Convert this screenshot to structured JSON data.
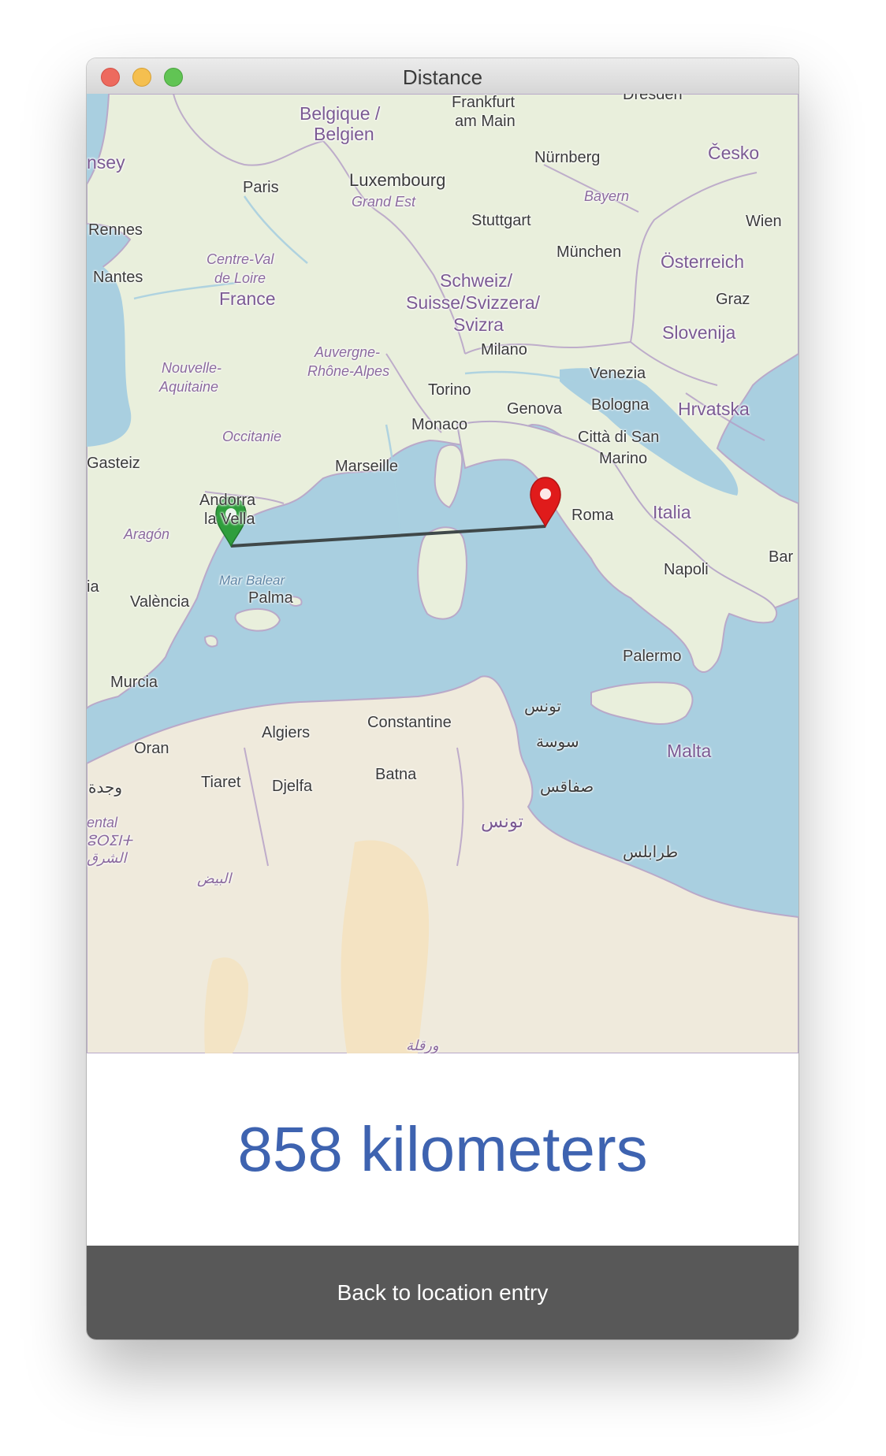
{
  "window": {
    "title": "Distance",
    "traffic_lights": [
      "close-button",
      "minimize-button",
      "zoom-button"
    ]
  },
  "map": {
    "labels": {
      "belgique": "Belgique /",
      "belgien": "Belgien",
      "frankfurt": "Frankfurt",
      "am_main": "am Main",
      "dresden": "Dresden",
      "cesko": "Česko",
      "nurnberg": "Nürnberg",
      "bayern": "Bayern",
      "jersey": "nsey",
      "paris": "Paris",
      "luxembourg": "Luxembourg",
      "grand_est": "Grand Est",
      "stuttgart": "Stuttgart",
      "wien": "Wien",
      "rennes": "Rennes",
      "centre_val": "Centre-Val",
      "de_loire": "de Loire",
      "munchen": "München",
      "osterreich": "Österreich",
      "nantes": "Nantes",
      "france": "France",
      "schweiz": "Schweiz/",
      "suisse": "Suisse/Svizzera/",
      "svizra": "Svizra",
      "graz": "Graz",
      "slovenija": "Slovenija",
      "auvergne": "Auvergne-",
      "rhone": "Rhône-Alpes",
      "milano": "Milano",
      "nouvelle": "Nouvelle-",
      "aquitaine": "Aquitaine",
      "torino": "Torino",
      "venezia": "Venezia",
      "genova": "Genova",
      "bologna": "Bologna",
      "hrvatska": "Hrvatska",
      "monaco": "Monaco",
      "occitanie": "Occitanie",
      "citta": "Città di San",
      "marino": "Marino",
      "gasteiz": "Gasteiz",
      "marseille": "Marseille",
      "andorra": "Andorra",
      "la_vella": "la Vella",
      "roma": "Roma",
      "italia": "Italia",
      "aragon": "Aragón",
      "bari": "Bar",
      "napoli": "Napoli",
      "mar_balear": "Mar Balear",
      "ia": "ia",
      "valencia": "València",
      "palma": "Palma",
      "palermo": "Palermo",
      "murcia": "Murcia",
      "tunis_city": "تونس",
      "constantine": "Constantine",
      "algiers": "Algiers",
      "sousse": "سوسة",
      "oran": "Oran",
      "malta": "Malta",
      "tiaret": "Tiaret",
      "djelfa": "Djelfa",
      "batna": "Batna",
      "oujda": "وجدة",
      "sfax": "صفاقس",
      "tunisia": "تونس",
      "oriental": "ental",
      "oriental_tif": "ⵓⵔⵉⵏⵜ",
      "sharq": "الشرق",
      "tripoli": "طرابلس",
      "bayadh": "البيض",
      "ouargla": "ورقلة"
    },
    "start_marker": "Barcelona",
    "end_marker": "Roma",
    "colors": {
      "water": "#a9cfe0",
      "land": "#eceee0",
      "start_marker": "#2f9e3c",
      "end_marker": "#e01b1b",
      "route": "#3f4849"
    }
  },
  "result": {
    "distance_text": "858 kilometers",
    "color": "#3e63b0"
  },
  "actions": {
    "back_label": "Back to location entry"
  }
}
